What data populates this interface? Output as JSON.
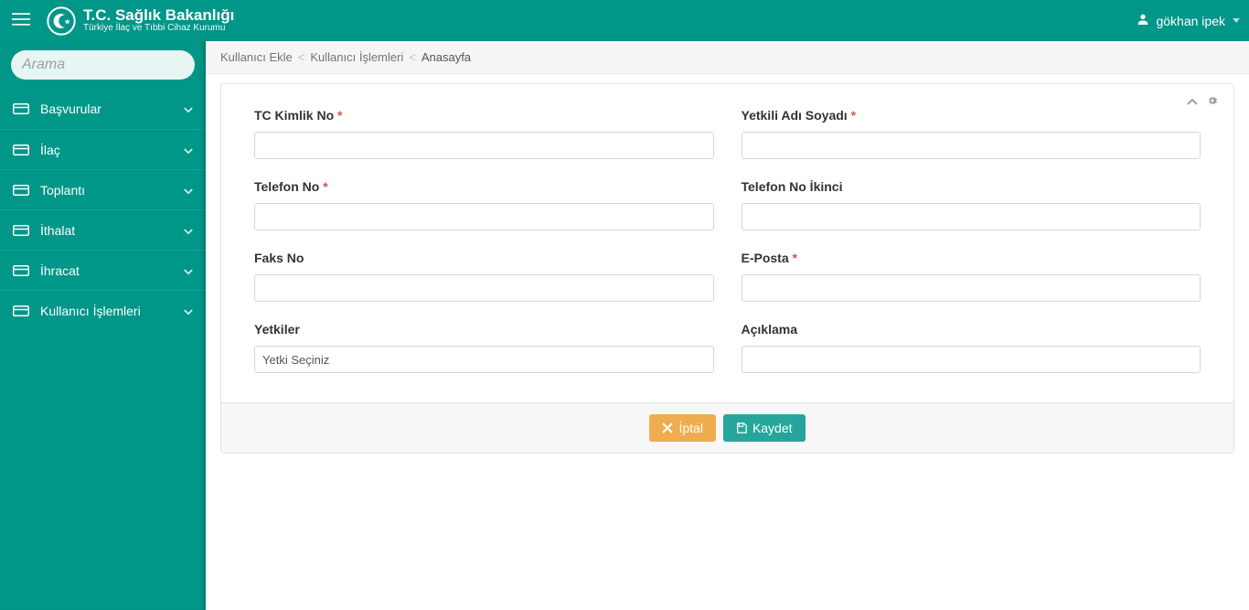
{
  "brand": {
    "title": "T.C. Sağlık Bakanlığı",
    "subtitle": "Türkiye İlaç ve Tıbbi Cihaz Kurumu"
  },
  "user": {
    "name": "gökhan ipek"
  },
  "search": {
    "placeholder": "Arama"
  },
  "sidebar": {
    "items": [
      {
        "label": "Başvurular"
      },
      {
        "label": "İlaç"
      },
      {
        "label": "Toplantı"
      },
      {
        "label": "İthalat"
      },
      {
        "label": "İhracat"
      },
      {
        "label": "Kullanıcı İşlemleri"
      }
    ]
  },
  "breadcrumb": {
    "first": "Kullanıcı Ekle",
    "second": "Kullanıcı İşlemleri",
    "last": "Anasayfa"
  },
  "form": {
    "tc_label": "TC Kimlik No",
    "name_label": "Yetkili Adı Soyadı",
    "phone_label": "Telefon No",
    "phone2_label": "Telefon No İkinci",
    "fax_label": "Faks No",
    "email_label": "E-Posta",
    "perm_label": "Yetkiler",
    "perm_placeholder": "Yetki Seçiniz",
    "desc_label": "Açıklama",
    "required_mark": "*"
  },
  "buttons": {
    "cancel": "İptal",
    "save": "Kaydet"
  }
}
